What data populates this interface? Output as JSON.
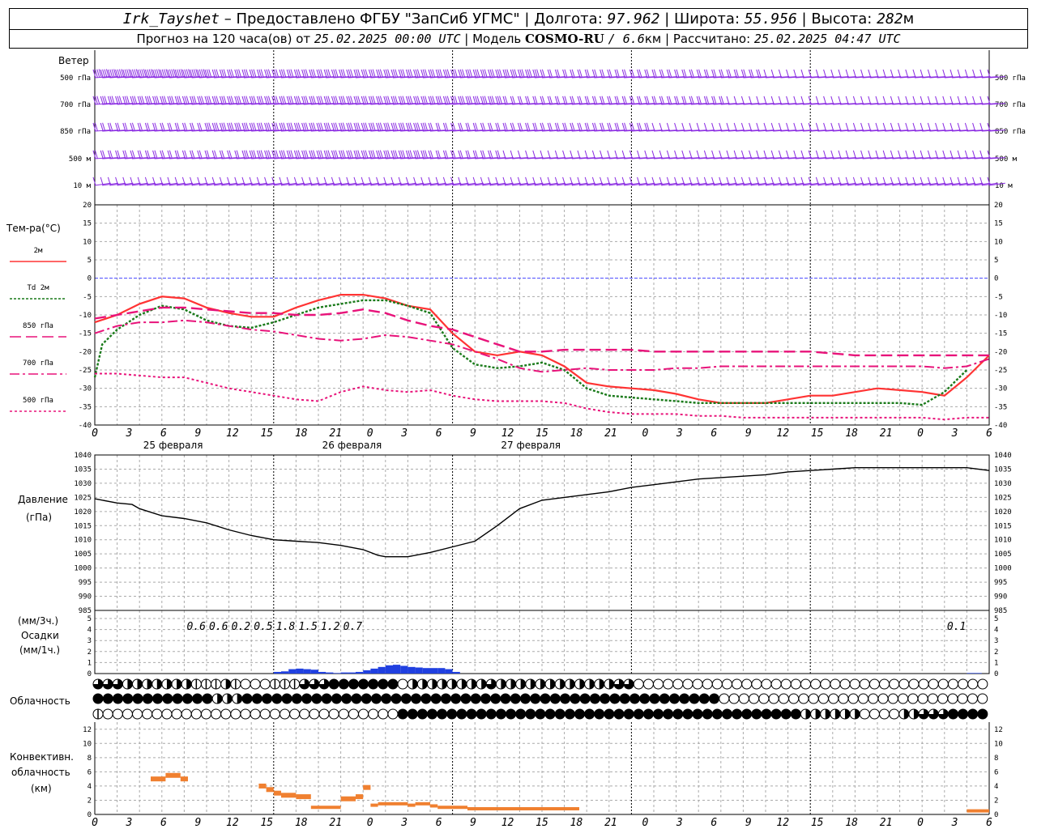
{
  "header": {
    "station": "Irk_Tayshet",
    "provider": "– Предоставлено ФГБУ \"ЗапСиб УГМС\"",
    "lon_label": "| Долгота:",
    "lon": "97.962",
    "lat_label": "| Широта:",
    "lat": "55.956",
    "alt_label": "| Высота:",
    "alt": "282",
    "alt_unit": "м",
    "forecast_label": "Прогноз на 120 часа(ов) от",
    "forecast_time": "25.02.2025 00:00 UTC",
    "model_label": "| Модель",
    "model": "COSMO-RU",
    "resolution": "/ 6.6",
    "resolution_unit": "км",
    "calc_label": "| Рассчитано:",
    "calc_time": "25.02.2025 04:47 UTC"
  },
  "labels": {
    "wind_title": "Ветер",
    "wind_levels": [
      "500 гПа",
      "700 гПа",
      "850 гПа",
      "500 м",
      "10  м"
    ],
    "temp_title": "Тем-ра(°C)",
    "temp_legend": [
      {
        "label": "2м",
        "color": "#ff3333",
        "dash": ""
      },
      {
        "label": "Td  2м",
        "color": "#1a7a1a",
        "dash": "3,2"
      },
      {
        "label": "850 гПа",
        "color": "#e8137a",
        "dash": "14,6"
      },
      {
        "label": "700 гПа",
        "color": "#e8137a",
        "dash": "12,4,3,4"
      },
      {
        "label": "500 гПа",
        "color": "#e8137a",
        "dash": "3,3"
      }
    ],
    "pressure_title": "Давление",
    "pressure_unit": "(гПа)",
    "precip_unit_top": "(мм/3ч.)",
    "precip_title": "Осадки",
    "precip_unit_bottom": "(мм/1ч.)",
    "cloud_title": "Облачность",
    "conv_title_1": "Конвективн.",
    "conv_title_2": "облачность",
    "conv_unit": "(км)"
  },
  "colors": {
    "wind": "#8a2be2",
    "t2m": "#ff3333",
    "td2m": "#1a7a1a",
    "upper": "#e8137a",
    "zero": "#4444ff",
    "pressure": "#000000",
    "precip": "#2040e0",
    "conv": "#f08030",
    "grid": "#aaaaaa"
  },
  "chart_data": {
    "type": "line",
    "x_hours": [
      0,
      120
    ],
    "x_tick_labels": [
      "0",
      "3",
      "6",
      "9",
      "12",
      "15",
      "18",
      "21",
      "0",
      "3",
      "6",
      "9",
      "12",
      "15",
      "18",
      "21",
      "0",
      "3",
      "6",
      "9",
      "12",
      "15",
      "18",
      "21",
      "0",
      "3",
      "6"
    ],
    "day_labels": [
      {
        "hour": 10.5,
        "label": "25 февраля"
      },
      {
        "hour": 34.5,
        "label": "26 февраля"
      },
      {
        "hour": 58.5,
        "label": "27 февраля"
      }
    ],
    "temperature": {
      "ylim": [
        -40,
        20
      ],
      "ticks": [
        20,
        15,
        10,
        5,
        0,
        -5,
        -10,
        -15,
        -20,
        -25,
        -30,
        -35,
        -40
      ],
      "series": [
        {
          "name": "2м",
          "x": [
            0,
            3,
            6,
            9,
            12,
            15,
            18,
            21,
            24,
            27,
            30,
            33,
            36,
            39,
            42,
            45,
            48,
            51,
            54,
            57,
            60,
            63,
            66,
            69,
            72,
            75,
            78,
            81,
            84,
            87,
            90,
            93,
            96,
            99,
            102,
            105,
            108,
            111,
            114,
            117,
            120
          ],
          "values": [
            -12,
            -10,
            -7,
            -5,
            -5.5,
            -8,
            -9.5,
            -10.5,
            -10.5,
            -8,
            -6,
            -4.5,
            -4.5,
            -5.5,
            -7.5,
            -8.5,
            -15,
            -20,
            -21,
            -20,
            -21,
            -24,
            -28.5,
            -29.5,
            -30,
            -30.5,
            -31.5,
            -33,
            -34,
            -34,
            -34,
            -33,
            -32,
            -32,
            -31,
            -30,
            -30.5,
            -31,
            -32,
            -27,
            -21
          ]
        },
        {
          "name": "Td 2м",
          "x": [
            0,
            1,
            3,
            6,
            9,
            12,
            15,
            18,
            21,
            24,
            27,
            30,
            33,
            36,
            39,
            42,
            45,
            48,
            51,
            54,
            57,
            60,
            63,
            66,
            69,
            72,
            75,
            78,
            81,
            84,
            87,
            90,
            93,
            96,
            99,
            102,
            105,
            108,
            111,
            114,
            117,
            120
          ],
          "values": [
            -27,
            -18,
            -14,
            -10,
            -7.5,
            -8.5,
            -11.5,
            -13,
            -13.5,
            -12,
            -10,
            -8,
            -7,
            -6,
            -6,
            -7.5,
            -9.5,
            -19,
            -23.5,
            -24.5,
            -24,
            -23,
            -25,
            -30,
            -32,
            -32.5,
            -33,
            -33.5,
            -34,
            -34,
            -34,
            -34,
            -34,
            -34,
            -34,
            -34,
            -34,
            -34,
            -34.5,
            -31,
            -25
          ]
        },
        {
          "name": "850 гПа",
          "x": [
            0,
            3,
            6,
            9,
            12,
            15,
            18,
            21,
            24,
            27,
            30,
            33,
            36,
            39,
            42,
            45,
            48,
            51,
            54,
            57,
            60,
            63,
            66,
            69,
            72,
            75,
            78,
            81,
            84,
            87,
            90,
            93,
            96,
            99,
            102,
            105,
            108,
            111,
            114,
            117,
            120
          ],
          "values": [
            -11,
            -10,
            -9,
            -8,
            -8,
            -8.5,
            -9,
            -9.5,
            -9.5,
            -10,
            -10,
            -9.5,
            -8.5,
            -9.5,
            -11.5,
            -13,
            -14,
            -16,
            -18,
            -20,
            -20,
            -19.5,
            -19.5,
            -19.5,
            -19.5,
            -20,
            -20,
            -20,
            -20,
            -20,
            -20,
            -20,
            -20,
            -20.5,
            -21,
            -21,
            -21,
            -21,
            -21,
            -21,
            -21
          ]
        },
        {
          "name": "700 гПа",
          "x": [
            0,
            3,
            6,
            9,
            12,
            15,
            18,
            21,
            24,
            27,
            30,
            33,
            36,
            39,
            42,
            45,
            48,
            51,
            54,
            57,
            60,
            63,
            66,
            69,
            72,
            75,
            78,
            81,
            84,
            87,
            90,
            93,
            96,
            99,
            102,
            105,
            108,
            111,
            114,
            117,
            120
          ],
          "values": [
            -15,
            -13,
            -12,
            -12,
            -11.5,
            -12,
            -13,
            -14,
            -14.5,
            -15.5,
            -16.5,
            -17,
            -16.5,
            -15.5,
            -16,
            -17,
            -18,
            -20,
            -22,
            -24.5,
            -25.5,
            -25,
            -24.5,
            -25,
            -25,
            -25,
            -24.5,
            -24.5,
            -24,
            -24,
            -24,
            -24,
            -24,
            -24,
            -24,
            -24,
            -24,
            -24,
            -24.5,
            -24,
            -22
          ]
        },
        {
          "name": "500 гПа",
          "x": [
            0,
            3,
            6,
            9,
            12,
            15,
            18,
            21,
            24,
            27,
            30,
            33,
            36,
            39,
            42,
            45,
            48,
            51,
            54,
            57,
            60,
            63,
            66,
            69,
            72,
            75,
            78,
            81,
            84,
            87,
            90,
            93,
            96,
            99,
            102,
            105,
            108,
            111,
            114,
            117,
            120
          ],
          "values": [
            -26,
            -26,
            -26.5,
            -27,
            -27,
            -28.5,
            -30,
            -31,
            -32,
            -33,
            -33.5,
            -31,
            -29.5,
            -30.5,
            -31,
            -30.5,
            -32,
            -33,
            -33.5,
            -33.5,
            -33.5,
            -34,
            -35.5,
            -36.5,
            -37,
            -37,
            -37,
            -37.5,
            -37.5,
            -38,
            -38,
            -38,
            -38,
            -38,
            -38,
            -38,
            -38,
            -38,
            -38.5,
            -38,
            -38
          ]
        }
      ]
    },
    "pressure": {
      "ylim": [
        985,
        1040
      ],
      "ticks": [
        1040,
        1035,
        1030,
        1025,
        1020,
        1015,
        1010,
        1005,
        1000,
        995,
        990,
        985
      ],
      "series": [
        {
          "name": "Давление",
          "x": [
            0,
            3,
            5,
            6,
            9,
            12,
            15,
            18,
            21,
            24,
            27,
            30,
            33,
            36,
            38,
            39,
            42,
            45,
            48,
            51,
            54,
            57,
            60,
            63,
            66,
            69,
            72,
            75,
            78,
            81,
            84,
            87,
            90,
            93,
            96,
            99,
            102,
            105,
            108,
            111,
            114,
            117,
            120
          ],
          "values": [
            1024.5,
            1023,
            1022.5,
            1021,
            1018.5,
            1017.5,
            1016,
            1013.5,
            1011.5,
            1010,
            1009.5,
            1009,
            1008,
            1006.5,
            1004.5,
            1004,
            1004,
            1005.5,
            1007.5,
            1009.5,
            1015,
            1021,
            1024,
            1025,
            1026,
            1027,
            1028.5,
            1029.5,
            1030.5,
            1031.5,
            1032,
            1032.5,
            1033,
            1034,
            1034.5,
            1035,
            1035.5,
            1035.5,
            1035.5,
            1035.5,
            1035.5,
            1035.5,
            1034.5
          ]
        }
      ]
    },
    "precipitation": {
      "ylim": [
        0,
        5
      ],
      "ticks": [
        5,
        4,
        3,
        2,
        1,
        0
      ],
      "labels_3h": [
        {
          "hour": 13.5,
          "value": "0.6"
        },
        {
          "hour": 16.5,
          "value": "0.6"
        },
        {
          "hour": 19.5,
          "value": "0.2"
        },
        {
          "hour": 22.5,
          "value": "0.5"
        },
        {
          "hour": 25.5,
          "value": "1.8"
        },
        {
          "hour": 28.5,
          "value": "1.5"
        },
        {
          "hour": 31.5,
          "value": "1.2"
        },
        {
          "hour": 34.5,
          "value": "0.7"
        },
        {
          "hour": 115.5,
          "value": "0.1"
        }
      ],
      "hourly_x": [
        24,
        25,
        26,
        27,
        28,
        29,
        30,
        31,
        32,
        33,
        34,
        35,
        36,
        37,
        38,
        39,
        40,
        41,
        42,
        43,
        44,
        45,
        46,
        47,
        48,
        117,
        118
      ],
      "hourly_values": [
        0.15,
        0.2,
        0.4,
        0.45,
        0.4,
        0.35,
        0.15,
        0.1,
        0.05,
        0.1,
        0.1,
        0.15,
        0.3,
        0.45,
        0.6,
        0.75,
        0.8,
        0.7,
        0.6,
        0.55,
        0.5,
        0.5,
        0.5,
        0.4,
        0.15,
        0.05,
        0.05
      ]
    },
    "cloud_rows": [
      "3332222222111210001113334444444022222222322222222222233000000000000000000000000000000000000",
      "444444444444222444444444444444444444444444444444444444444444444000000000000000000000000000",
      "1000000000000000000000000000000444444444444444444444444444444444444444442222220000223334444"
    ],
    "convective": {
      "ylim": [
        0,
        13
      ],
      "ticks": [
        12,
        10,
        8,
        6,
        4,
        2,
        0
      ],
      "segments": [
        [
          7.5,
          9.5,
          5
        ],
        [
          9.5,
          11.5,
          5.5
        ],
        [
          11.5,
          12.5,
          5
        ],
        [
          22,
          23,
          4
        ],
        [
          23,
          24,
          3.5
        ],
        [
          24,
          25,
          3
        ],
        [
          25,
          27,
          2.7
        ],
        [
          27,
          29,
          2.5
        ],
        [
          29,
          33,
          1
        ],
        [
          33,
          35,
          2.2
        ],
        [
          35,
          36,
          2.5
        ],
        [
          36,
          37,
          3.8
        ],
        [
          37,
          38,
          1.3
        ],
        [
          38,
          42,
          1.5
        ],
        [
          42,
          43,
          1.3
        ],
        [
          43,
          45,
          1.5
        ],
        [
          45,
          46,
          1.2
        ],
        [
          46,
          50,
          1
        ],
        [
          50,
          55,
          0.8
        ],
        [
          55,
          65,
          0.8
        ],
        [
          117,
          120,
          0.5
        ]
      ]
    }
  }
}
